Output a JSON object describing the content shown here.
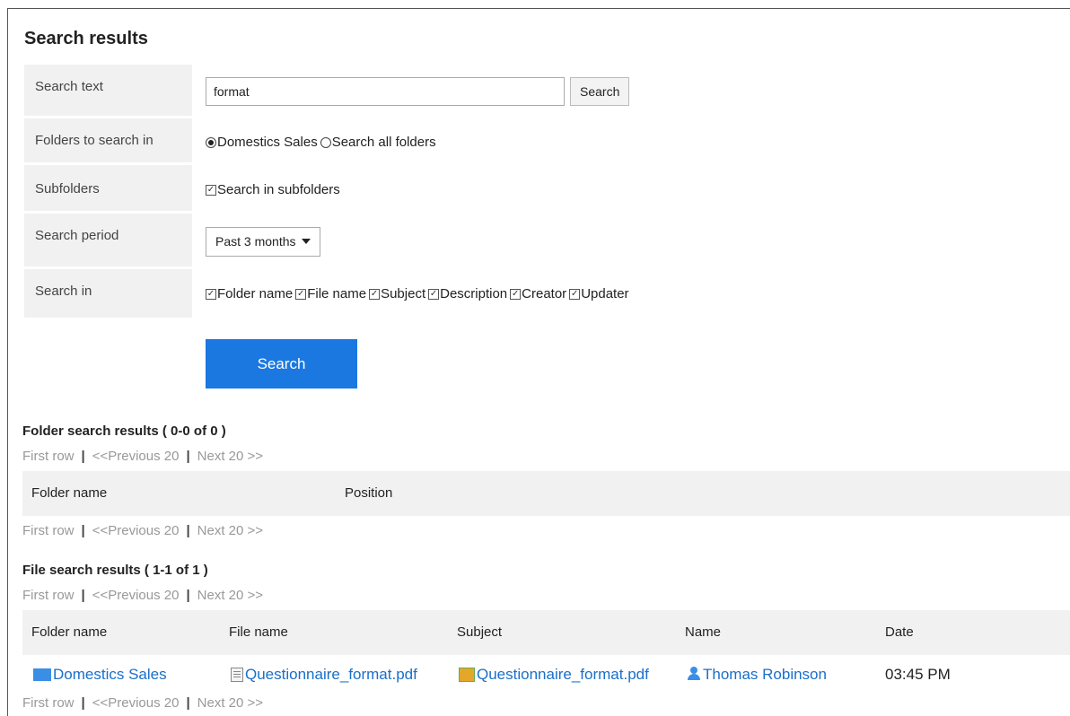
{
  "page": {
    "title": "Search results"
  },
  "form": {
    "search_text": {
      "label": "Search text",
      "value": "format",
      "button": "Search"
    },
    "folders": {
      "label": "Folders to search in",
      "options": [
        {
          "label": "Domestics Sales",
          "checked": true
        },
        {
          "label": "Search all folders",
          "checked": false
        }
      ]
    },
    "subfolders": {
      "label": "Subfolders",
      "option": "Search in subfolders"
    },
    "period": {
      "label": "Search period",
      "selected": "Past 3 months"
    },
    "search_in": {
      "label": "Search in",
      "options": [
        "Folder name",
        "File name",
        "Subject",
        "Description",
        "Creator",
        "Updater"
      ]
    },
    "submit": "Search"
  },
  "pager": {
    "first": "First row",
    "prev": "<<Previous 20",
    "next": "Next 20 >>",
    "sep": "|"
  },
  "folder_results": {
    "title": "Folder search results ( 0-0 of 0 )",
    "columns": [
      "Folder name",
      "Position"
    ]
  },
  "file_results": {
    "title": "File search results ( 1-1 of 1 )",
    "columns": [
      "Folder name",
      "File name",
      "Subject",
      "Name",
      "Date"
    ],
    "rows": [
      {
        "folder": "Domestics Sales",
        "file": "Questionnaire_format.pdf",
        "subject": "Questionnaire_format.pdf",
        "name": "Thomas Robinson",
        "date": "03:45 PM"
      }
    ]
  },
  "icons": {
    "folder": "folder-icon",
    "file": "file-icon",
    "subject": "subject-icon",
    "user": "user-icon"
  },
  "colors": {
    "primary_button": "#1a78e0",
    "link": "#1a6fc9"
  }
}
